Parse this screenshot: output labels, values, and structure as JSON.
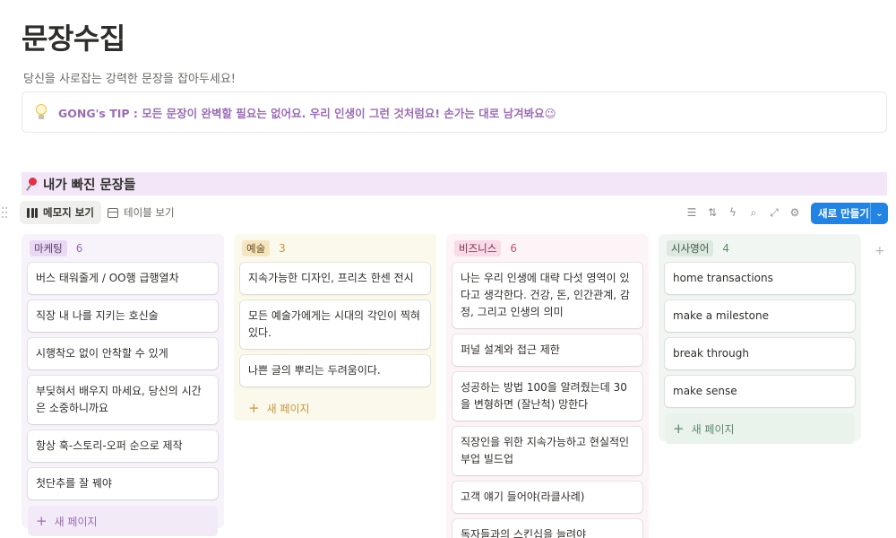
{
  "page": {
    "title": "문장수집",
    "subtitle": "당신을 사로잡는 강력한 문장을 잡아두세요!"
  },
  "callout": {
    "icon": "lightbulb-icon",
    "text": "GONG's TIP : 모든 문장이 완벽할 필요는 없어요. 우리 인생이 그런 것처럼요! 손가는 대로 남겨봐요😉"
  },
  "section": {
    "icon": "pushpin-icon",
    "title": "내가 빠진 문장들"
  },
  "views": {
    "board_label": "메모지 보기",
    "table_label": "테이블 보기"
  },
  "toolbar": {
    "new_label": "새로 만들기",
    "icons": [
      "filter-icon",
      "sort-icon",
      "automation-icon",
      "search-icon",
      "expand-icon",
      "settings-icon"
    ]
  },
  "board": {
    "add_page_label": "새 페이지",
    "columns": [
      {
        "name": "마케팅",
        "count": "6",
        "color": "#ead9f3",
        "cards": [
          "버스 태워줄게 / OO행 급행열차",
          "직장 내 나를 지키는 호신술",
          "시행착오 없이 안착할 수 있게",
          "부딪혀서 배우지 마세요, 당신의 시간은 소중하니까요",
          "항상 훅-스토리-오퍼 순으로 제작",
          "첫단추를 잘 꿰야"
        ]
      },
      {
        "name": "예술",
        "count": "3",
        "color": "#f5e6c2",
        "cards": [
          "지속가능한 디자인, 프리츠 한센 전시",
          "모든 예술가에게는 시대의 각인이 찍혀 있다.",
          "나쁜 글의 뿌리는 두려움이다."
        ]
      },
      {
        "name": "비즈니스",
        "count": "6",
        "color": "#f8dbe6",
        "cards": [
          "나는 우리 인생에 대략 다섯 영역이 있다고 생각한다. 건강, 돈, 인간관계, 감정, 그리고 인생의 의미",
          "퍼널 설계와 접근 제한",
          "성공하는 방법 100을 알려줬는데 30을 변형하면 (잘난척) 망한다",
          "직장인을 위한 지속가능하고 현실적인 부업 빌드업",
          "고객 얘기 들어야(라클사례)",
          "독자들과의 스킨십을 늘려야"
        ]
      },
      {
        "name": "시사영어",
        "count": "4",
        "color": "#dde8e0",
        "cards": [
          "home transactions",
          "make a milestone",
          "break through",
          "make sense"
        ]
      }
    ]
  }
}
